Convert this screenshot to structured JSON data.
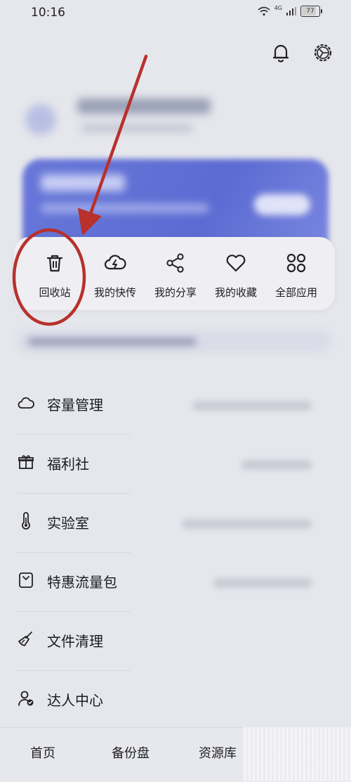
{
  "status_bar": {
    "time": "10:16",
    "network": "4G",
    "battery": "77",
    "battery_level": 0.77
  },
  "header": {
    "icons": [
      "bell-icon",
      "settings-icon"
    ]
  },
  "quick_actions": [
    {
      "label": "回收站",
      "icon": "trash-icon"
    },
    {
      "label": "我的快传",
      "icon": "cloud-bolt-icon"
    },
    {
      "label": "我的分享",
      "icon": "share-icon"
    },
    {
      "label": "我的收藏",
      "icon": "heart-icon"
    },
    {
      "label": "全部应用",
      "icon": "apps-grid-icon"
    }
  ],
  "menu": [
    {
      "label": "容量管理",
      "icon": "cloud-outline-icon"
    },
    {
      "label": "福利社",
      "icon": "gift-icon"
    },
    {
      "label": "实验室",
      "icon": "thermometer-icon"
    },
    {
      "label": "特惠流量包",
      "icon": "package-icon"
    },
    {
      "label": "文件清理",
      "icon": "broom-icon"
    },
    {
      "label": "达人中心",
      "icon": "verified-user-icon"
    }
  ],
  "bottom_nav": [
    {
      "label": "首页"
    },
    {
      "label": "备份盘"
    },
    {
      "label": "资源库"
    }
  ],
  "colors": {
    "annotation": "#b8312c",
    "card_blue": "#5b6bd2",
    "background": "#e6e7ed"
  }
}
